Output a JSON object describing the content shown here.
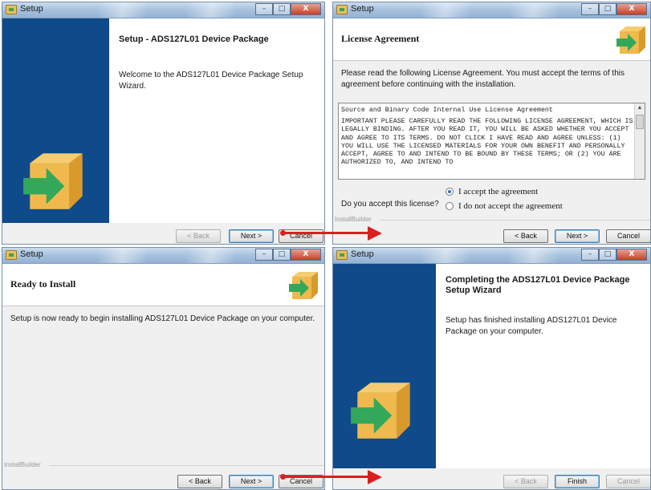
{
  "window_title": "Setup",
  "installbuilder_label": "InstallBuilder",
  "buttons": {
    "back": "< Back",
    "next": "Next >",
    "cancel": "Cancel",
    "finish": "Finish"
  },
  "welcome": {
    "title": "Setup - ADS127L01 Device Package",
    "text": "Welcome to the ADS127L01 Device Package Setup Wizard."
  },
  "license": {
    "title": "License Agreement",
    "intro": "Please read the following License Agreement. You must accept the terms of this agreement before continuing with the installation.",
    "body_heading": "Source and Binary Code Internal Use License Agreement",
    "body_text": "IMPORTANT  PLEASE CAREFULLY READ THE FOLLOWING LICENSE AGREEMENT, WHICH IS LEGALLY BINDING.  AFTER YOU READ IT, YOU WILL BE ASKED WHETHER YOU ACCEPT AND AGREE TO ITS TERMS.  DO NOT CLICK  I HAVE READ AND AGREE UNLESS: (1) YOU WILL USE THE LICENSED MATERIALS FOR YOUR OWN BENEFIT AND PERSONALLY ACCEPT, AGREE TO AND INTEND TO BE BOUND BY THESE TERMS; OR (2) YOU ARE AUTHORIZED TO, AND INTEND TO",
    "question": "Do you accept this license?",
    "accept": "I accept the agreement",
    "decline": "I do not accept the agreement"
  },
  "ready": {
    "title": "Ready to Install",
    "text": "Setup is now ready to begin installing ADS127L01 Device Package on your computer."
  },
  "complete": {
    "title": "Completing the ADS127L01 Device Package Setup Wizard",
    "text": "Setup has finished installing ADS127L01 Device Package on your computer."
  },
  "colors": {
    "side_panel": "#0f4a8a",
    "arrow": "#d92020",
    "box": "#efb94e",
    "box_arrow": "#33a85a"
  }
}
